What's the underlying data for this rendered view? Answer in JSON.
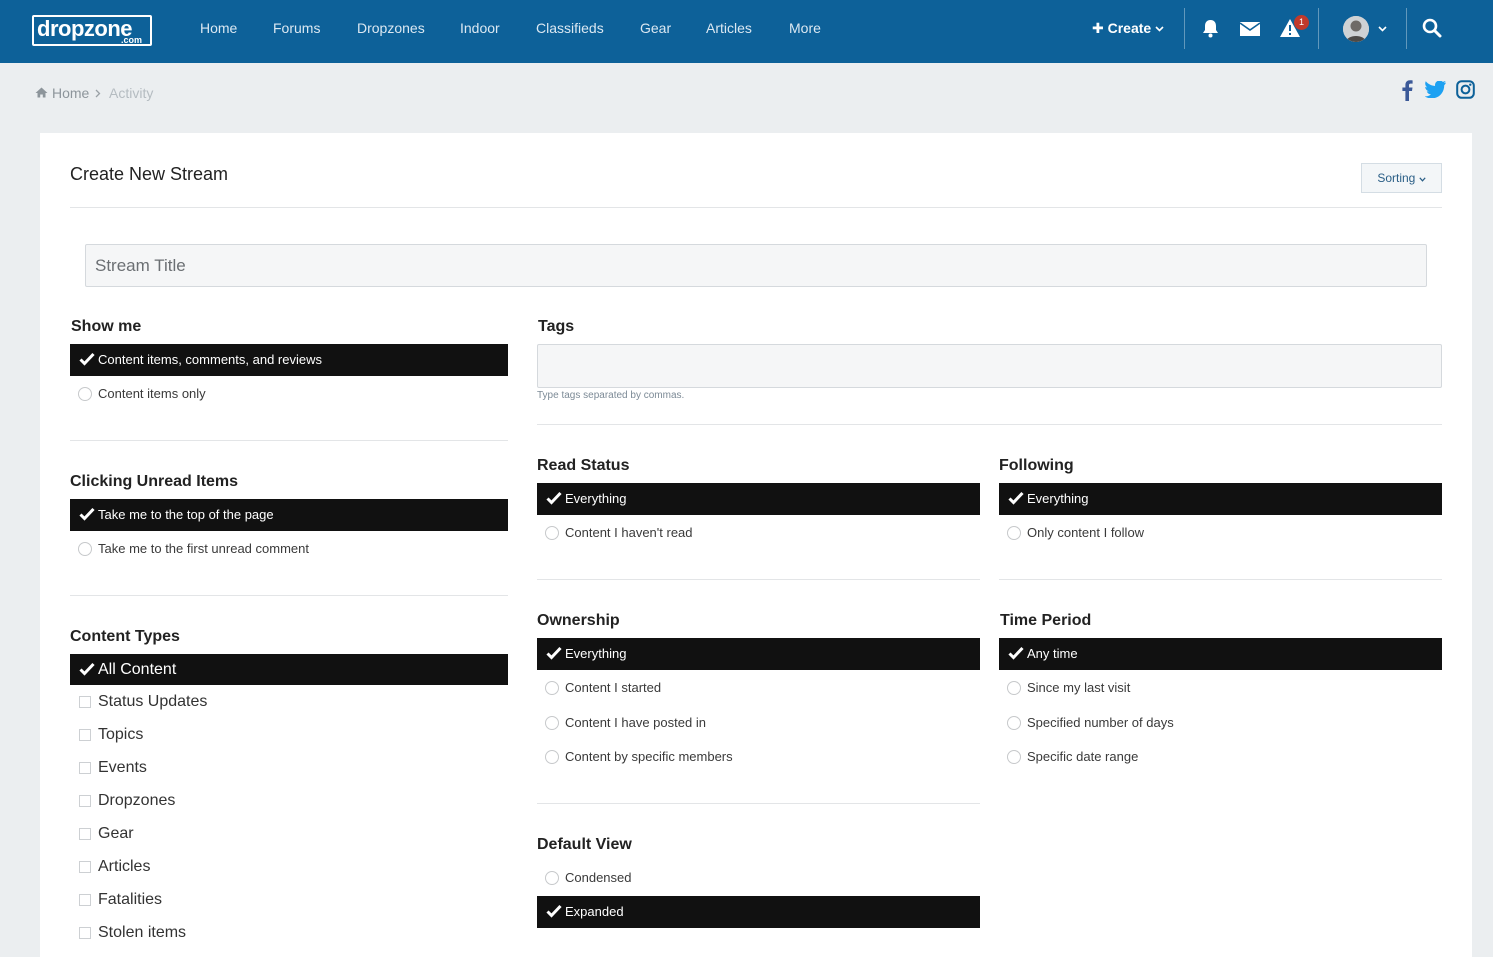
{
  "header": {
    "logo_main": "dropzone",
    "logo_sub": ".com",
    "nav": [
      "Home",
      "Forums",
      "Dropzones",
      "Indoor",
      "Classifieds",
      "Gear",
      "Articles",
      "More"
    ],
    "create_label": "Create",
    "notification_count": "1"
  },
  "breadcrumb": {
    "home": "Home",
    "current": "Activity"
  },
  "page": {
    "title": "Create New Stream",
    "sorting_label": "Sorting"
  },
  "stream_title": {
    "placeholder": "Stream Title"
  },
  "show_me": {
    "title": "Show me",
    "options": [
      "Content items, comments, and reviews",
      "Content items only"
    ],
    "selected": "Content items, comments, and reviews"
  },
  "tags": {
    "title": "Tags",
    "hint": "Type tags separated by commas."
  },
  "clicking_unread": {
    "title": "Clicking Unread Items",
    "options": [
      "Take me to the top of the page",
      "Take me to the first unread comment"
    ],
    "selected": "Take me to the top of the page"
  },
  "read_status": {
    "title": "Read Status",
    "options": [
      "Everything",
      "Content I haven't read"
    ],
    "selected": "Everything"
  },
  "following": {
    "title": "Following",
    "options": [
      "Everything",
      "Only content I follow"
    ],
    "selected": "Everything"
  },
  "content_types": {
    "title": "Content Types",
    "selected": "All Content",
    "options": [
      "Status Updates",
      "Topics",
      "Events",
      "Dropzones",
      "Gear",
      "Articles",
      "Fatalities",
      "Stolen items"
    ]
  },
  "ownership": {
    "title": "Ownership",
    "options": [
      "Everything",
      "Content I started",
      "Content I have posted in",
      "Content by specific members"
    ],
    "selected": "Everything"
  },
  "time_period": {
    "title": "Time Period",
    "options": [
      "Any time",
      "Since my last visit",
      "Specified number of days",
      "Specific date range"
    ],
    "selected": "Any time"
  },
  "default_view": {
    "title": "Default View",
    "options": [
      "Condensed",
      "Expanded"
    ],
    "selected": "Expanded"
  },
  "colors": {
    "header_bg": "#0d6199",
    "selected_bg": "#111111",
    "facebook": "#3b5998",
    "twitter": "#1da1f2"
  }
}
